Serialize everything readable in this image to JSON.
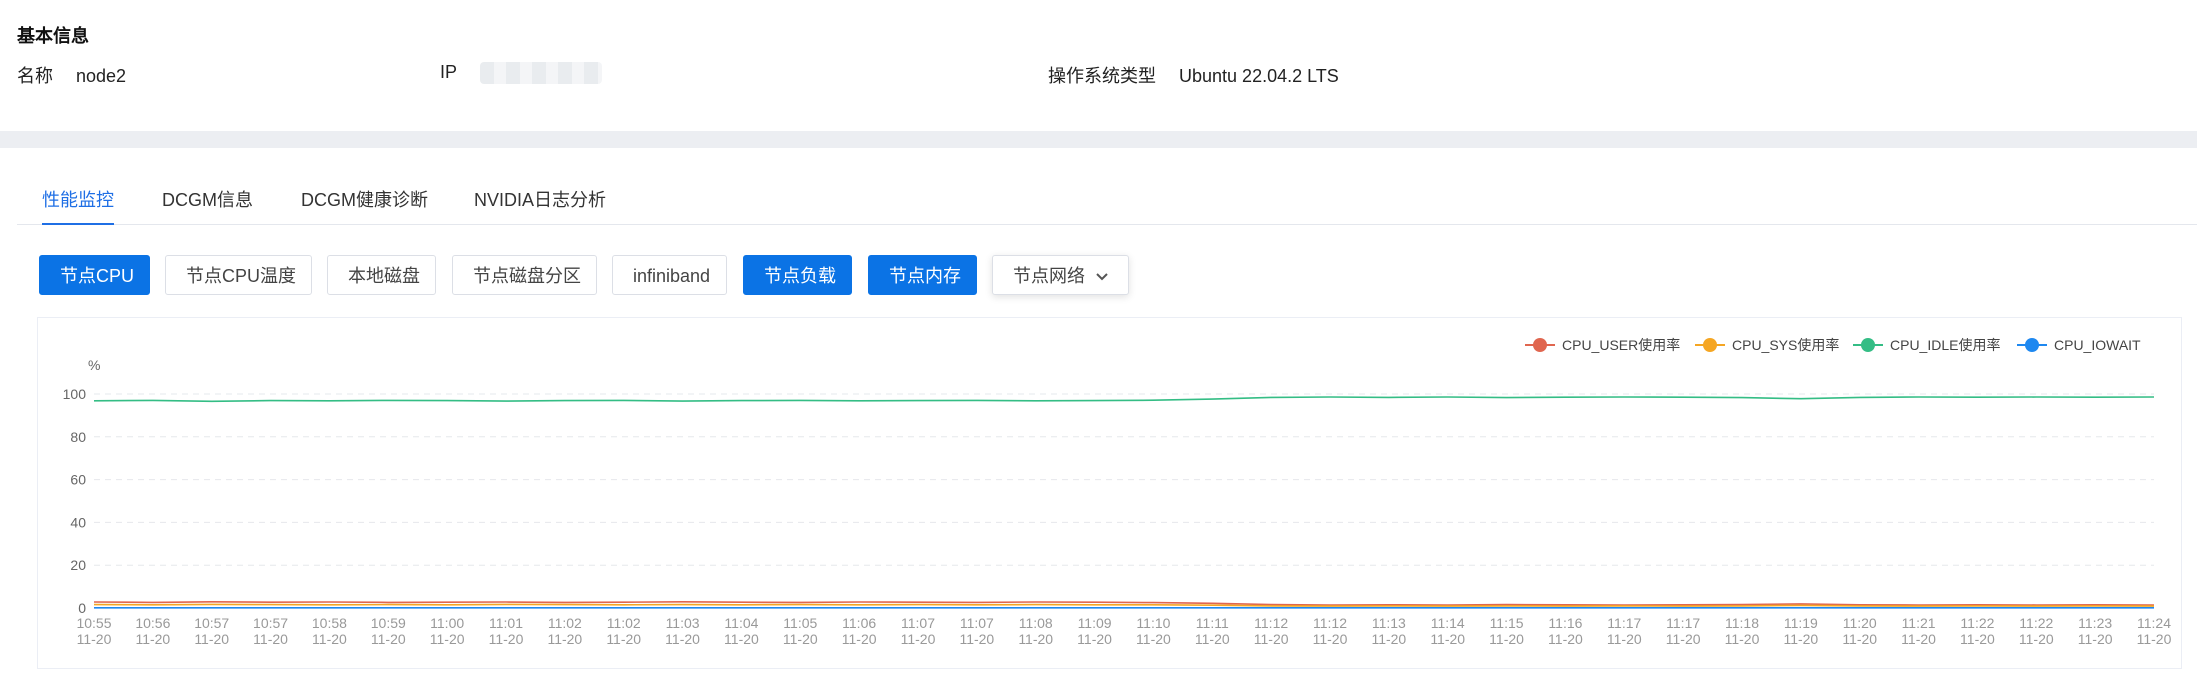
{
  "basic_info": {
    "title": "基本信息",
    "name_label": "名称",
    "name_value": "node2",
    "ip_label": "IP",
    "os_label": "操作系统类型",
    "os_value": "Ubuntu 22.04.2 LTS"
  },
  "tabs": [
    {
      "label": "性能监控",
      "active": true
    },
    {
      "label": "DCGM信息",
      "active": false
    },
    {
      "label": "DCGM健康诊断",
      "active": false
    },
    {
      "label": "NVIDIA日志分析",
      "active": false
    }
  ],
  "metric_buttons": [
    {
      "label": "节点CPU",
      "selected": true
    },
    {
      "label": "节点CPU温度",
      "selected": false
    },
    {
      "label": "本地磁盘",
      "selected": false
    },
    {
      "label": "节点磁盘分区",
      "selected": false
    },
    {
      "label": "infiniband",
      "selected": false
    },
    {
      "label": "节点负载",
      "selected": true
    },
    {
      "label": "节点内存",
      "selected": true
    },
    {
      "label": "节点网络",
      "selected": false,
      "dropdown": true,
      "icon": "chevron-down-icon"
    }
  ],
  "colors": {
    "primary": "#0b73e5",
    "cpu_user": "#e0664f",
    "cpu_sys": "#f5a623",
    "cpu_idle": "#34bd85",
    "cpu_iowait": "#1e88f0"
  },
  "chart_data": {
    "type": "line",
    "ylabel": "%",
    "ylim": [
      0,
      100
    ],
    "yticks": [
      0,
      20,
      40,
      60,
      80,
      100
    ],
    "grid": true,
    "legend_position": "top-right",
    "x": [
      "10:55 11-20",
      "10:56 11-20",
      "10:57 11-20",
      "10:57 11-20",
      "10:58 11-20",
      "10:59 11-20",
      "11:00 11-20",
      "11:01 11-20",
      "11:02 11-20",
      "11:02 11-20",
      "11:03 11-20",
      "11:04 11-20",
      "11:05 11-20",
      "11:06 11-20",
      "11:07 11-20",
      "11:07 11-20",
      "11:08 11-20",
      "11:09 11-20",
      "11:10 11-20",
      "11:11 11-20",
      "11:12 11-20",
      "11:12 11-20",
      "11:13 11-20",
      "11:14 11-20",
      "11:15 11-20",
      "11:16 11-20",
      "11:17 11-20",
      "11:17 11-20",
      "11:18 11-20",
      "11:19 11-20",
      "11:20 11-20",
      "11:21 11-20",
      "11:22 11-20",
      "11:22 11-20",
      "11:23 11-20",
      "11:24 11-20"
    ],
    "series": [
      {
        "name": "CPU_USER使用率",
        "color": "#e0664f",
        "values": [
          2.8,
          2.6,
          2.9,
          2.7,
          2.8,
          2.6,
          2.7,
          2.8,
          2.6,
          2.7,
          2.9,
          2.7,
          2.6,
          2.8,
          2.7,
          2.6,
          2.8,
          2.7,
          2.5,
          2.2,
          1.6,
          1.4,
          1.5,
          1.4,
          1.6,
          1.5,
          1.4,
          1.5,
          1.6,
          1.9,
          1.5,
          1.4,
          1.5,
          1.4,
          1.5,
          1.4
        ]
      },
      {
        "name": "CPU_SYS使用率",
        "color": "#f5a623",
        "values": [
          1.6,
          1.5,
          1.7,
          1.6,
          1.5,
          1.6,
          1.5,
          1.7,
          1.6,
          1.5,
          1.6,
          1.5,
          1.6,
          1.5,
          1.6,
          1.5,
          1.6,
          1.5,
          1.5,
          1.3,
          1.0,
          0.9,
          1.0,
          0.9,
          1.0,
          0.9,
          1.0,
          0.9,
          1.0,
          1.2,
          1.0,
          0.9,
          1.0,
          0.9,
          1.0,
          0.9
        ]
      },
      {
        "name": "CPU_IDLE使用率",
        "color": "#34bd85",
        "values": [
          96.8,
          97.0,
          96.6,
          96.9,
          96.8,
          97.0,
          96.9,
          96.7,
          96.9,
          97.0,
          96.7,
          96.9,
          97.0,
          96.8,
          96.9,
          97.0,
          96.8,
          96.9,
          97.1,
          97.6,
          98.4,
          98.6,
          98.4,
          98.6,
          98.3,
          98.5,
          98.6,
          98.5,
          98.3,
          97.8,
          98.4,
          98.6,
          98.5,
          98.6,
          98.5,
          98.6
        ]
      },
      {
        "name": "CPU_IOWAIT",
        "color": "#1e88f0",
        "values": [
          0.1,
          0.1,
          0.1,
          0.1,
          0.1,
          0.1,
          0.1,
          0.1,
          0.1,
          0.1,
          0.1,
          0.1,
          0.1,
          0.1,
          0.1,
          0.1,
          0.1,
          0.1,
          0.1,
          0.1,
          0.1,
          0.1,
          0.1,
          0.1,
          0.1,
          0.1,
          0.1,
          0.1,
          0.1,
          0.1,
          0.1,
          0.1,
          0.1,
          0.1,
          0.1,
          0.1
        ]
      }
    ]
  }
}
